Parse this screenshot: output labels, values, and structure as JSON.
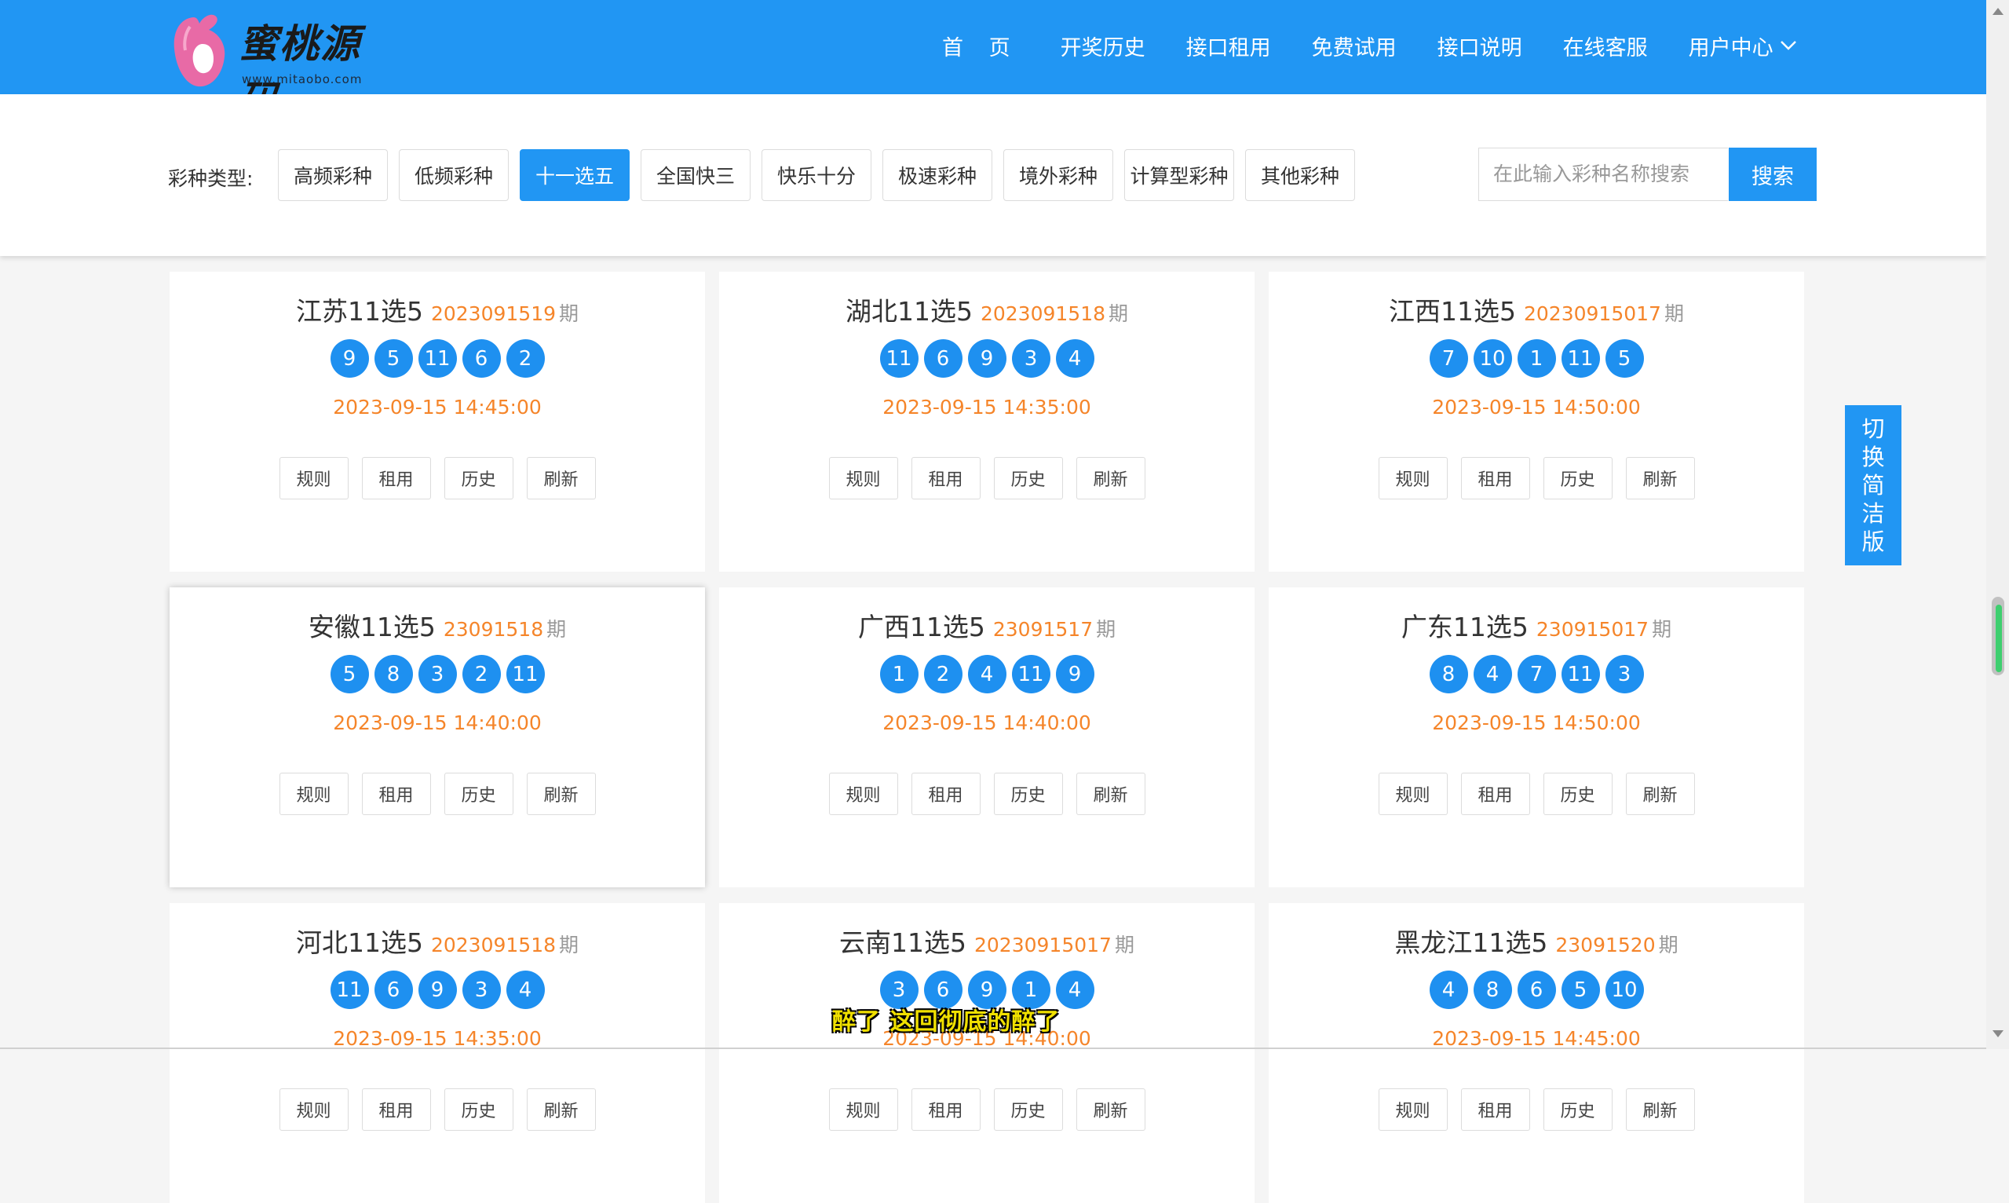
{
  "brand": {
    "name": "蜜桃源码",
    "url": "www.mitaobo.com",
    "primary_color": "#2196f3",
    "ball_color": "#1e90f0",
    "accent_color": "#f5852a"
  },
  "nav": {
    "home": "首 页",
    "history": "开奖历史",
    "rent": "接口租用",
    "trial": "免费试用",
    "docs": "接口说明",
    "service": "在线客服",
    "user_center": "用户中心",
    "user_center_icon": "chevron-down-icon"
  },
  "filter": {
    "label": "彩种类型:",
    "types": [
      "高频彩种",
      "低频彩种",
      "十一选五",
      "全国快三",
      "快乐十分",
      "极速彩种",
      "境外彩种",
      "计算型彩种",
      "其他彩种"
    ],
    "active": "十一选五",
    "search_placeholder": "在此输入彩种名称搜索",
    "search_button": "搜索"
  },
  "period_suffix": "期",
  "actions": [
    "规则",
    "租用",
    "历史",
    "刷新"
  ],
  "cards": [
    {
      "name": "江苏11选5",
      "period": "2023091519",
      "balls": [
        "9",
        "5",
        "11",
        "6",
        "2"
      ],
      "time": "2023-09-15 14:45:00"
    },
    {
      "name": "湖北11选5",
      "period": "2023091518",
      "balls": [
        "11",
        "6",
        "9",
        "3",
        "4"
      ],
      "time": "2023-09-15 14:35:00"
    },
    {
      "name": "江西11选5",
      "period": "20230915017",
      "balls": [
        "7",
        "10",
        "1",
        "11",
        "5"
      ],
      "time": "2023-09-15 14:50:00"
    },
    {
      "name": "安徽11选5",
      "period": "23091518",
      "balls": [
        "5",
        "8",
        "3",
        "2",
        "11"
      ],
      "time": "2023-09-15 14:40:00"
    },
    {
      "name": "广西11选5",
      "period": "23091517",
      "balls": [
        "1",
        "2",
        "4",
        "11",
        "9"
      ],
      "time": "2023-09-15 14:40:00"
    },
    {
      "name": "广东11选5",
      "period": "230915017",
      "balls": [
        "8",
        "4",
        "7",
        "11",
        "3"
      ],
      "time": "2023-09-15 14:50:00"
    },
    {
      "name": "河北11选5",
      "period": "2023091518",
      "balls": [
        "11",
        "6",
        "9",
        "3",
        "4"
      ],
      "time": "2023-09-15 14:35:00"
    },
    {
      "name": "云南11选5",
      "period": "20230915017",
      "balls": [
        "3",
        "6",
        "9",
        "1",
        "4"
      ],
      "time": "2023-09-15 14:40:00"
    },
    {
      "name": "黑龙江11选5",
      "period": "23091520",
      "balls": [
        "4",
        "8",
        "6",
        "5",
        "10"
      ],
      "time": "2023-09-15 14:45:00"
    }
  ],
  "side_float": [
    "切",
    "换",
    "简",
    "洁",
    "版"
  ],
  "subtitle": "醉了 这回彻底的醉了"
}
